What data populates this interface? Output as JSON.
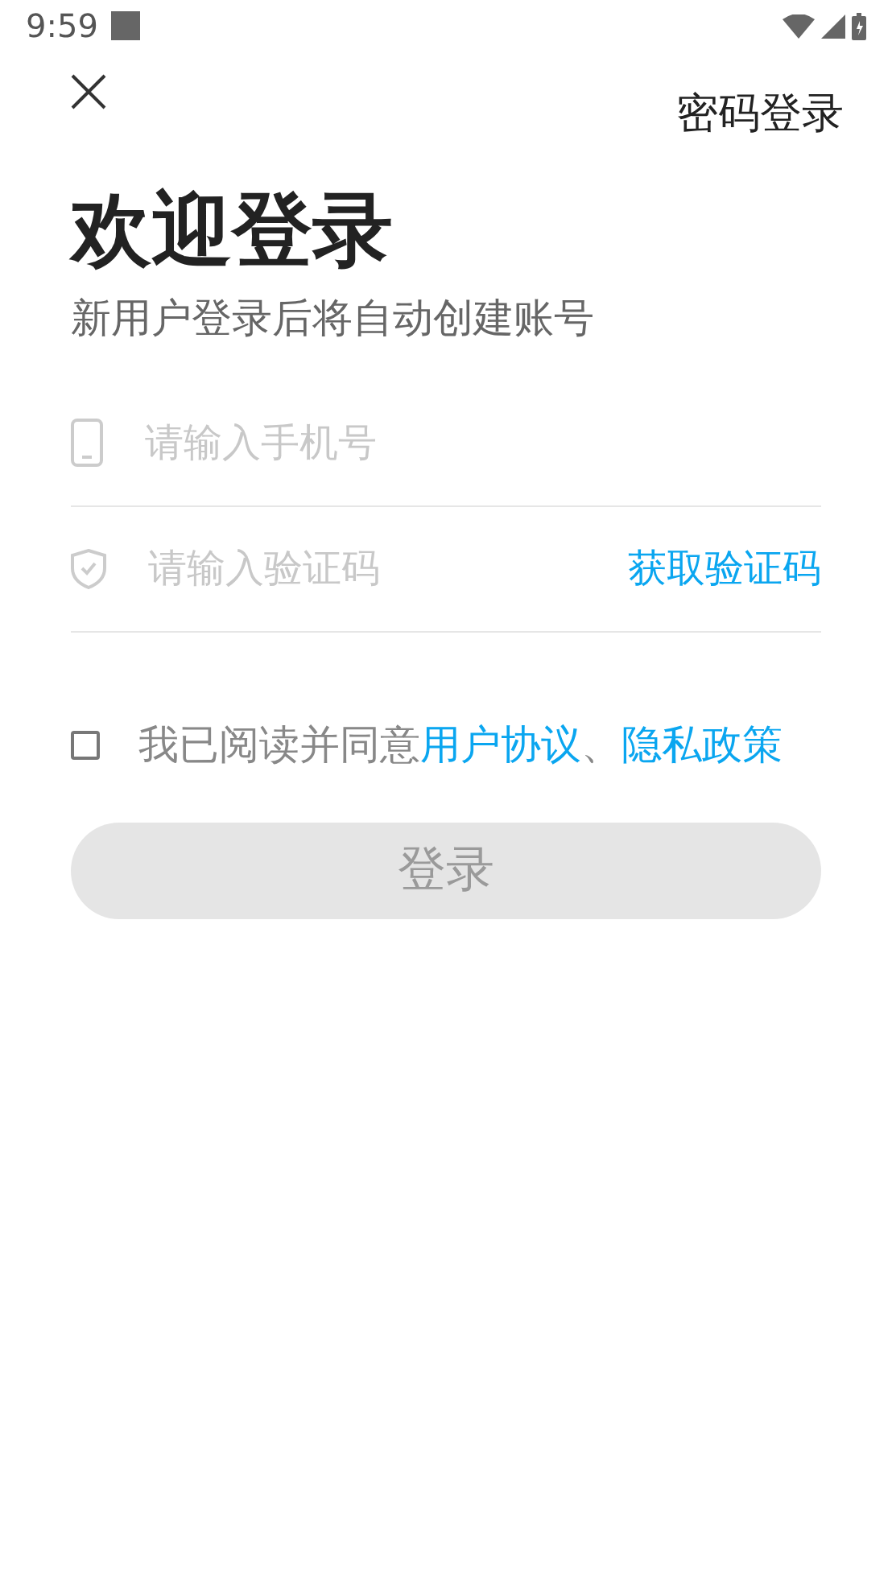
{
  "status_bar": {
    "time": "9:59"
  },
  "header": {
    "password_login": "密码登录"
  },
  "title": "欢迎登录",
  "subtitle": "新用户登录后将自动创建账号",
  "fields": [
    {
      "kind": "phone",
      "placeholder": "请输入手机号"
    },
    {
      "kind": "code",
      "placeholder": "请输入验证码",
      "action": "获取验证码"
    }
  ],
  "agreement": {
    "checked": false,
    "text": "我已阅读并同意",
    "link_1": "用户协议",
    "separator": "、",
    "link_2": "隐私政策"
  },
  "login_button": {
    "label": "登录",
    "disabled": true
  }
}
